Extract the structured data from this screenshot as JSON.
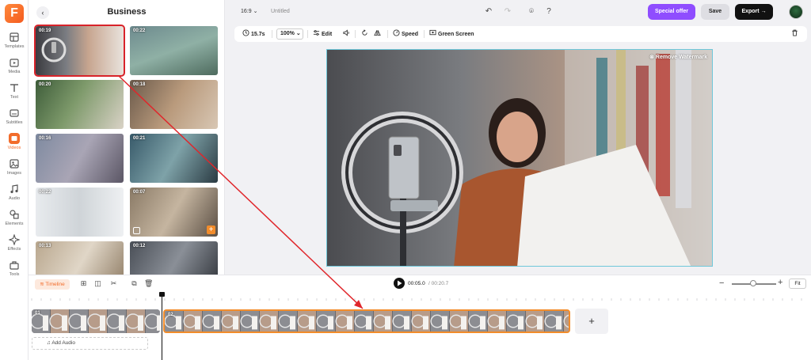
{
  "brand": {
    "logo_letter": "F",
    "accent": "#f26c2b"
  },
  "rail": {
    "items": [
      {
        "label": "Templates"
      },
      {
        "label": "Media"
      },
      {
        "label": "Text"
      },
      {
        "label": "Subtitles"
      },
      {
        "label": "Videos",
        "active": true
      },
      {
        "label": "Images"
      },
      {
        "label": "Audio"
      },
      {
        "label": "Elements"
      },
      {
        "label": "Effects"
      },
      {
        "label": "Tools"
      }
    ]
  },
  "panel": {
    "back_icon": "chevron-left-icon",
    "title": "Business",
    "thumbs": [
      {
        "duration": "00:19",
        "selected": true
      },
      {
        "duration": "00:22"
      },
      {
        "duration": "00:20"
      },
      {
        "duration": "00:18"
      },
      {
        "duration": "00:16"
      },
      {
        "duration": "00:21"
      },
      {
        "duration": "00:22"
      },
      {
        "duration": "00:07"
      },
      {
        "duration": "00:13"
      },
      {
        "duration": "00:12"
      }
    ]
  },
  "topbar": {
    "ratio": "16:9",
    "project_title": "Untitled",
    "special_offer": "Special offer",
    "save": "Save",
    "export": "Export"
  },
  "toolbar": {
    "duration": "15.7s",
    "zoom": "100%",
    "edit": "Edit",
    "speed": "Speed",
    "green_screen": "Green Screen"
  },
  "preview": {
    "watermark": "Remove Watermark"
  },
  "timeline": {
    "tab": "Timeline",
    "current_time": "00:05.0",
    "total_time": "/ 00:20.7",
    "fit": "Fit",
    "zoom_level": 0.48,
    "clips": [
      {
        "number": "01"
      },
      {
        "number": "02",
        "selected": true
      }
    ],
    "add_audio": "Add Audio"
  }
}
